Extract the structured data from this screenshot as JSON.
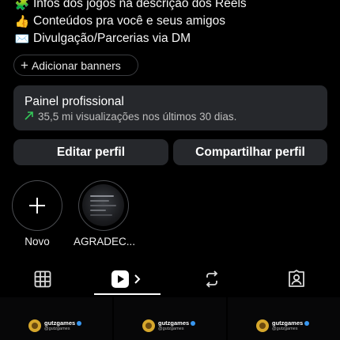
{
  "bio": {
    "lines": [
      {
        "emoji": "🧩",
        "text": "Infos dos jogos na descrição dos Reels"
      },
      {
        "emoji": "👍",
        "text": "Conteúdos pra você e seus amigos"
      },
      {
        "emoji": "✉️",
        "text": "Divulgação/Parcerias via DM"
      }
    ]
  },
  "banner_button": {
    "label": "Adicionar banners"
  },
  "professional_panel": {
    "title": "Painel profissional",
    "subtitle": "35,5 mi visualizações nos últimos 30 dias."
  },
  "profile_actions": {
    "edit_label": "Editar perfil",
    "share_label": "Compartilhar perfil"
  },
  "highlights": [
    {
      "label": "Novo",
      "icon": "plus-icon"
    },
    {
      "label": "AGRADEC..."
    }
  ],
  "tabs": [
    {
      "icon": "grid-icon",
      "active": false
    },
    {
      "icon": "reels-icon",
      "active": true
    },
    {
      "icon": "repost-icon",
      "active": false
    },
    {
      "icon": "tagged-icon",
      "active": false
    }
  ],
  "posts": [
    {
      "account": "gutzgames",
      "handle": "@gutzgames"
    },
    {
      "account": "gutzgames",
      "handle": "@gutzgames"
    },
    {
      "account": "gutzgames",
      "handle": "@gutzgames"
    }
  ],
  "colors": {
    "background": "#000000",
    "card": "#26282c",
    "trend_green": "#34c759",
    "verified_blue": "#3897f0"
  }
}
